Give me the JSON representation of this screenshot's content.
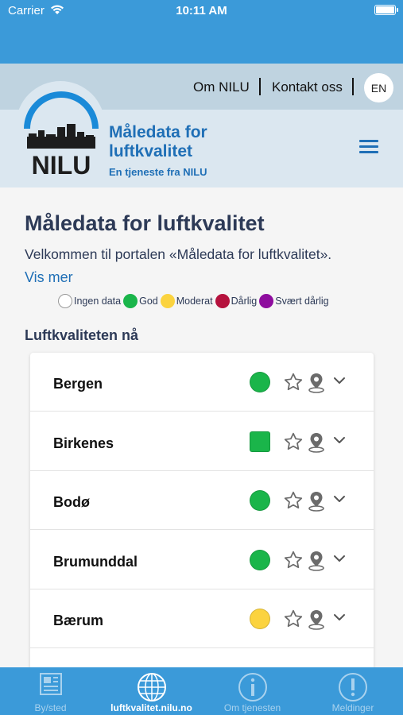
{
  "status_bar": {
    "carrier": "Carrier",
    "time": "10:11 AM"
  },
  "top_links": {
    "about": "Om NILU",
    "contact": "Kontakt oss",
    "language": "EN"
  },
  "brand": {
    "logo_text": "NILU",
    "title": "Måledata for luftkvalitet",
    "subtitle": "En tjeneste fra NILU",
    "color": "#1f6fb6"
  },
  "main": {
    "title": "Måledata for luftkvalitet",
    "intro": "Velkommen til portalen «Måledata for luftkvalitet».",
    "read_more": "Vis mer",
    "section_title": "Luftkvaliteten nå"
  },
  "legend": [
    {
      "label": "Ingen data",
      "color": "#ffffff"
    },
    {
      "label": "God",
      "color": "#1ab54a"
    },
    {
      "label": "Moderat",
      "color": "#fbd33f"
    },
    {
      "label": "Dårlig",
      "color": "#b5123d"
    },
    {
      "label": "Svært dårlig",
      "color": "#8e0d9e"
    }
  ],
  "locations": [
    {
      "name": "Bergen",
      "status_color": "#1ab54a",
      "status_shape": "circle"
    },
    {
      "name": "Birkenes",
      "status_color": "#1ab54a",
      "status_shape": "square"
    },
    {
      "name": "Bodø",
      "status_color": "#1ab54a",
      "status_shape": "circle"
    },
    {
      "name": "Brumunddal",
      "status_color": "#1ab54a",
      "status_shape": "circle"
    },
    {
      "name": "Bærum",
      "status_color": "#fbd33f",
      "status_shape": "circle"
    },
    {
      "name": "",
      "status_color": "",
      "status_shape": "circle"
    }
  ],
  "tabs": [
    {
      "label": "By/sted",
      "icon": "newspaper-icon",
      "active": false
    },
    {
      "label": "luftkvalitet.nilu.no",
      "icon": "globe-icon",
      "active": true
    },
    {
      "label": "Om tjenesten",
      "icon": "info-icon",
      "active": false
    },
    {
      "label": "Meldinger",
      "icon": "alert-icon",
      "active": false
    }
  ]
}
